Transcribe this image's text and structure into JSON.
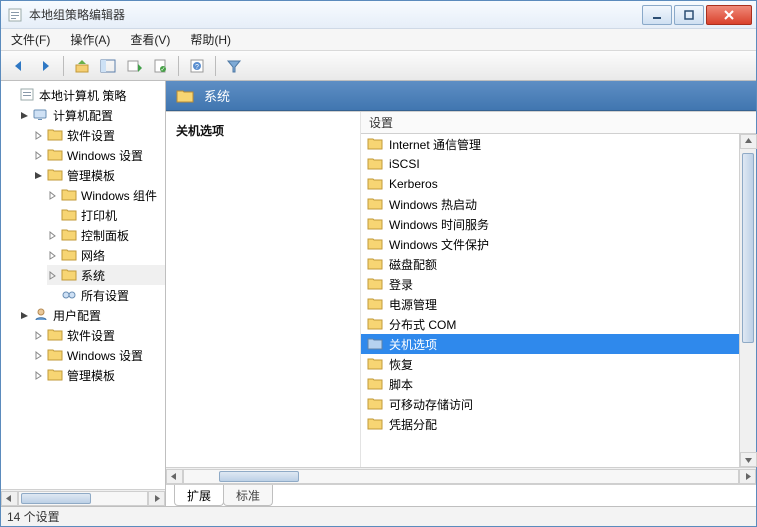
{
  "window": {
    "title": "本地组策略编辑器"
  },
  "menu": {
    "file": "文件(F)",
    "action": "操作(A)",
    "view": "查看(V)",
    "help": "帮助(H)"
  },
  "tree": {
    "root": "本地计算机 策略",
    "computer": "计算机配置",
    "c_soft": "软件设置",
    "c_win": "Windows 设置",
    "c_admin": "管理模板",
    "c_admin_wincomp": "Windows 组件",
    "c_admin_printer": "打印机",
    "c_admin_cp": "控制面板",
    "c_admin_net": "网络",
    "c_admin_sys": "系统",
    "c_admin_all": "所有设置",
    "user": "用户配置",
    "u_soft": "软件设置",
    "u_win": "Windows 设置",
    "u_admin": "管理模板"
  },
  "header": {
    "title": "系统"
  },
  "detail": {
    "section": "关机选项"
  },
  "list": {
    "header": "设置",
    "items": [
      "Internet 通信管理",
      "iSCSI",
      "Kerberos",
      "Windows 热启动",
      "Windows 时间服务",
      "Windows 文件保护",
      "磁盘配额",
      "登录",
      "电源管理",
      "分布式 COM",
      "关机选项",
      "恢复",
      "脚本",
      "可移动存储访问",
      "凭据分配"
    ],
    "selected_index": 10
  },
  "tabs": {
    "extended": "扩展",
    "standard": "标准"
  },
  "status": {
    "text": "14 个设置"
  }
}
